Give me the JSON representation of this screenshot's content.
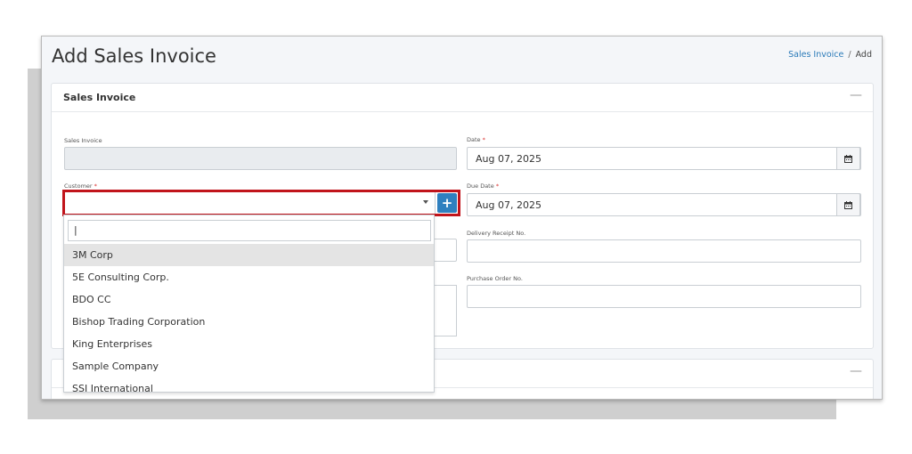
{
  "page": {
    "title": "Add Sales Invoice"
  },
  "breadcrumb": {
    "link": "Sales Invoice",
    "separator": "/",
    "current": "Add"
  },
  "card": {
    "title": "Sales Invoice",
    "collapse_symbol": "—"
  },
  "fields": {
    "sales_invoice": {
      "label": "Sales Invoice",
      "value": ""
    },
    "date": {
      "label": "Date",
      "required_mark": "*",
      "value": "Aug 07, 2025"
    },
    "customer": {
      "label": "Customer",
      "required_mark": "*",
      "value": "",
      "add_symbol": "+"
    },
    "due_date": {
      "label": "Due Date",
      "required_mark": "*",
      "value": "Aug 07, 2025"
    },
    "delivery_receipt": {
      "label": "Delivery Receipt No.",
      "value": ""
    },
    "purchase_order": {
      "label": "Purchase Order No.",
      "value": ""
    }
  },
  "dropdown": {
    "search_value": "|",
    "options": [
      "3M Corp",
      "5E Consulting Corp.",
      "BDO CC",
      "Bishop Trading Corporation",
      "King Enterprises",
      "Sample Company",
      "SSI International"
    ],
    "highlighted_index": 0
  },
  "card2": {
    "collapse_symbol": "—"
  },
  "colors": {
    "accent": "#2f80bf",
    "highlight_border": "#c1141b",
    "required": "#d9312f",
    "link": "#2a7ab8"
  },
  "icons": {
    "date_addon": "calendar-icon",
    "due_date_addon": "calendar-icon",
    "select_toggle": "chevron-down-icon",
    "add_customer": "plus-icon"
  }
}
